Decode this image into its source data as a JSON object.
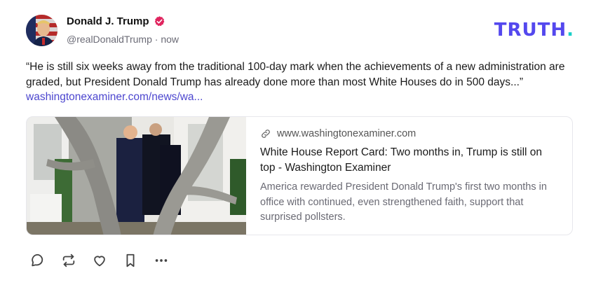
{
  "author": {
    "display_name": "Donald J. Trump",
    "handle": "@realDonaldTrump",
    "separator": "·",
    "time": "now",
    "avatar_icon": "avatar-image",
    "verified_icon": "verified-badge-icon",
    "verified_color": "#e0245e"
  },
  "brand": {
    "logo_text": "TRUTH",
    "logo_dot": ".",
    "color": "#5448ee",
    "dot_color": "#19d0c8"
  },
  "post": {
    "text": "“He is still six weeks away from the traditional 100-day mark when the achievements of a new administration are graded, but President Donald Trump has already done more than most White Houses do in 500 days...”",
    "link_text": "washingtonexaminer.com/news/wa...",
    "link_color": "#4c46cf"
  },
  "card": {
    "domain": "www.washingtonexaminer.com",
    "title": "White House Report Card: Two months in, Trump is still on top - Washington Examiner",
    "description": "America rewarded President Donald Trump's first two months in office with continued, even strengthened faith, support that surprised pollsters.",
    "image_icon": "article-photo"
  },
  "actions": [
    {
      "name": "reply-button",
      "icon": "speech-bubble-icon"
    },
    {
      "name": "retruth-button",
      "icon": "repost-icon"
    },
    {
      "name": "like-button",
      "icon": "heart-icon"
    },
    {
      "name": "bookmark-button",
      "icon": "bookmark-icon"
    },
    {
      "name": "more-options-button",
      "icon": "ellipsis-icon"
    }
  ]
}
